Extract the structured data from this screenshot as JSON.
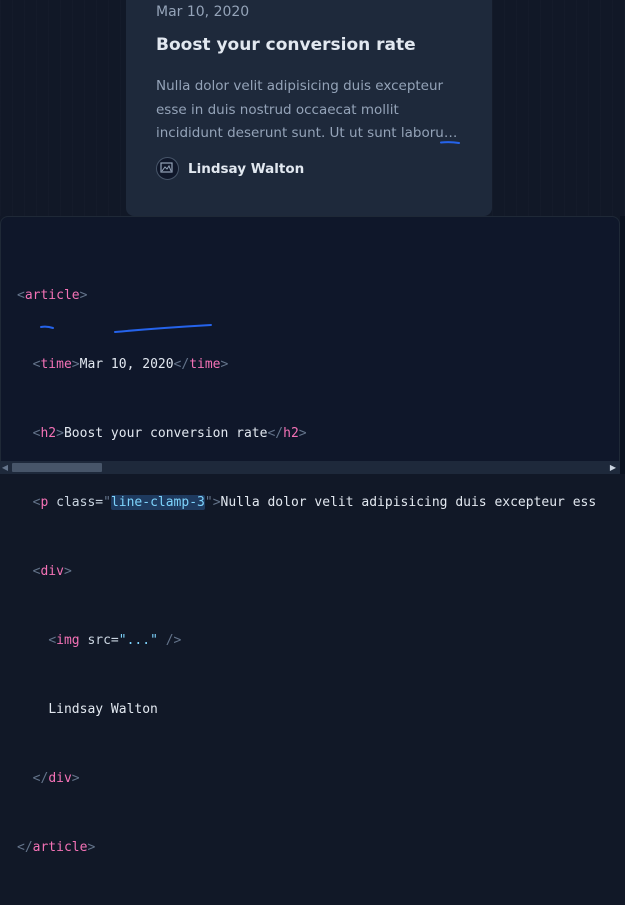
{
  "preview": {
    "date": "Mar 10, 2020",
    "title": "Boost your conversion rate",
    "excerpt": "Nulla dolor velit adipisicing duis excepteur esse in duis nostrud occaecat mollit incididunt deserunt sunt. Ut ut sunt laborum ex occaecat eu tempor labore enim adipisicing minim ad.",
    "author": "Lindsay Walton",
    "line_clamp": 3
  },
  "code": {
    "line1": {
      "open": "<",
      "tag": "article",
      "close": ">"
    },
    "line2": {
      "indent": "  ",
      "open": "<",
      "tag": "time",
      "close": ">",
      "text": "Mar 10, 2020",
      "end_open": "</",
      "end_tag": "time",
      "end_close": ">"
    },
    "line3": {
      "indent": "  ",
      "open": "<",
      "tag": "h2",
      "close": ">",
      "text": "Boost your conversion rate",
      "end_open": "</",
      "end_tag": "h2",
      "end_close": ">"
    },
    "line4": {
      "indent": "  ",
      "open": "<",
      "tag": "p",
      "attr": " class=",
      "q1": "\"",
      "value": "line-clamp-3",
      "q2": "\"",
      "close": ">",
      "text": "Nulla dolor velit adipisicing duis excepteur ess"
    },
    "line5": {
      "indent": "  ",
      "open": "<",
      "tag": "div",
      "close": ">"
    },
    "line6": {
      "indent": "    ",
      "open": "<",
      "tag": "img",
      "attr": " src=",
      "value": "\"...\"",
      "close": " />"
    },
    "line7": {
      "indent": "    ",
      "text": "Lindsay Walton"
    },
    "line8": {
      "indent": "  ",
      "open": "</",
      "tag": "div",
      "close": ">"
    },
    "line9": {
      "open": "</",
      "tag": "article",
      "close": ">"
    }
  },
  "scrollbar": {
    "left_arrow": "◀",
    "right_arrow": "▶"
  },
  "colors": {
    "tag": "#f472b6",
    "punct": "#64748b",
    "string": "#7dd3fc",
    "ink": "#2563eb"
  }
}
